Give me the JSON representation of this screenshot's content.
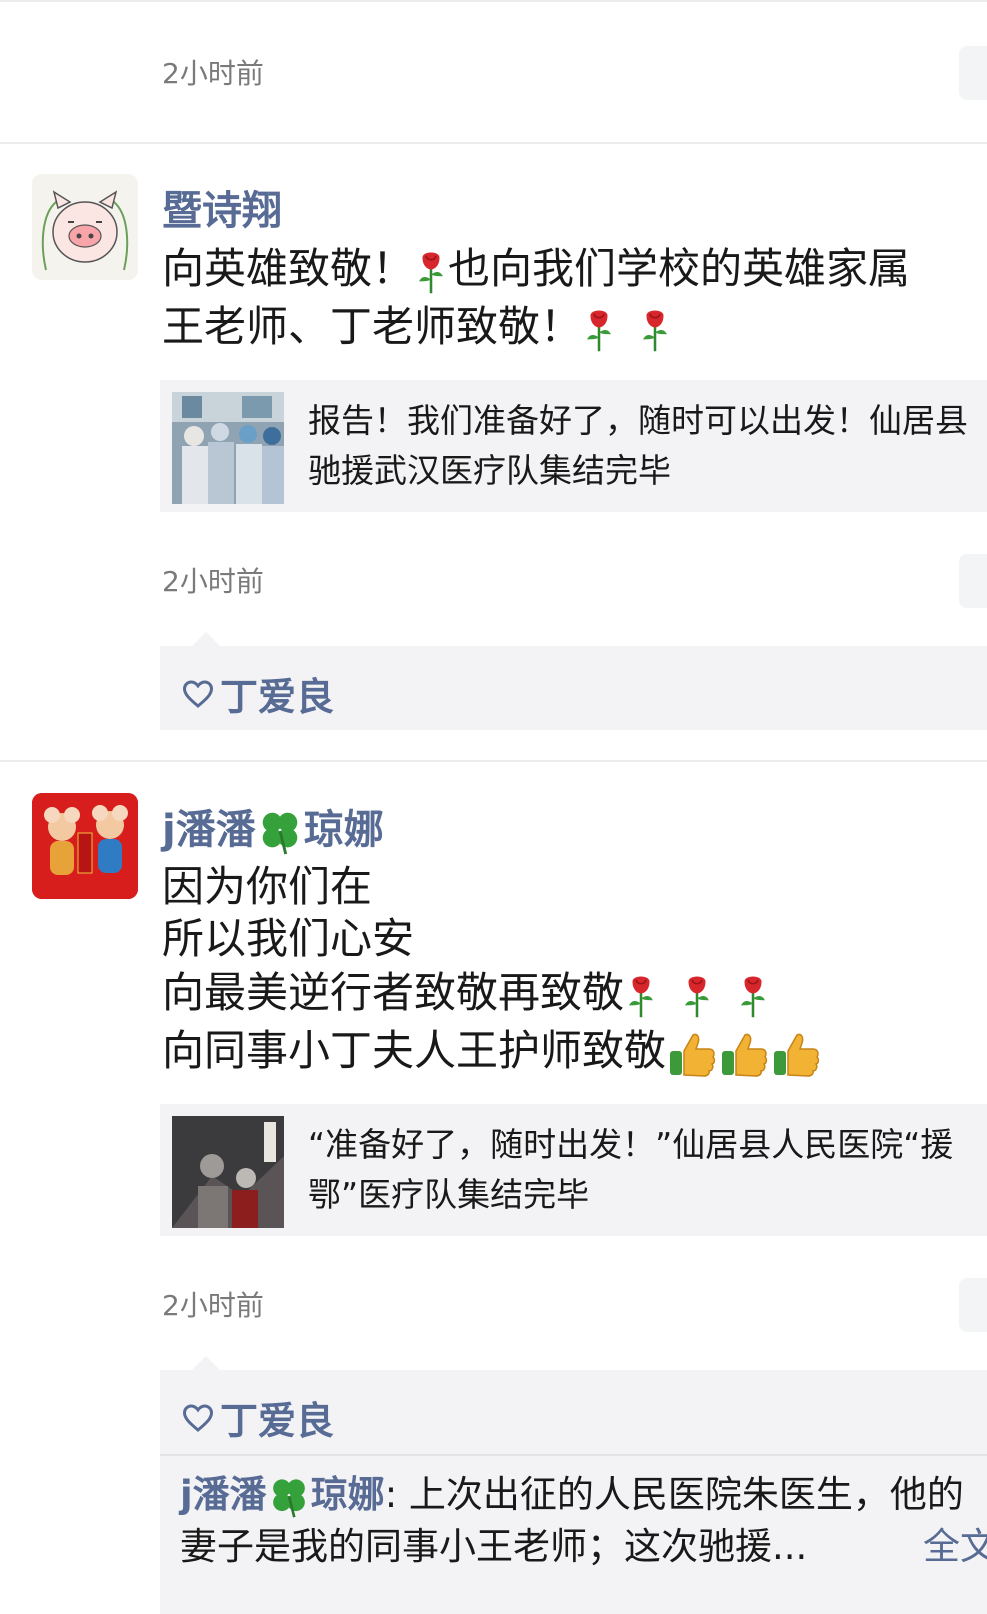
{
  "posts": [
    {
      "time": "2小时前"
    },
    {
      "name": "暨诗翔",
      "lines": [
        "向英雄致敬！",
        "也向我们学校的英雄家属",
        "王老师、丁老师致敬！"
      ],
      "link": {
        "title": "报告！我们准备好了，随时可以出发！仙居县驰援武汉医疗队集结完毕"
      },
      "time": "2小时前",
      "likes": "丁爱良"
    },
    {
      "name_part1": "j潘潘",
      "name_part2": "琼娜",
      "lines": [
        "因为你们在",
        "所以我们心安",
        "向最美逆行者致敬再致敬",
        "向同事小丁夫人王护师致敬"
      ],
      "link": {
        "title": "“准备好了，随时出发！”仙居县人民医院“援鄂”医疗队集结完毕"
      },
      "time": "2小时前",
      "likes": "丁爱良",
      "comment": {
        "author_part1": "j潘潘",
        "author_part2": "琼娜",
        "text_line1": ": 上次出征的人民医院朱医生，他的",
        "text_line2": "妻子是我的同事小王老师；这次驰援...",
        "full_label": "全文"
      }
    }
  ],
  "icons": {
    "rose": "rose-emoji",
    "clover": "four-leaf-clover-emoji",
    "thumbs_up": "thumbs-up-emoji",
    "heart": "heart-outline-icon"
  },
  "colors": {
    "name_blue": "#576b95",
    "card_bg": "#f3f3f5",
    "time_gray": "#7a7a7a"
  }
}
